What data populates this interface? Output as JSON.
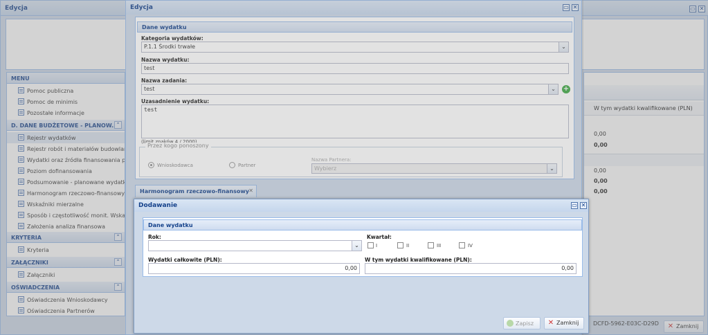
{
  "bg_window": {
    "title": "Edycja",
    "record_id": "DCFD-5962-E03C-D29D",
    "close_label": "Zamknij",
    "table_header": "W tym wydatki kwalifikowane (PLN)",
    "values": [
      "0,00",
      "0,00",
      "0,00",
      "0,00",
      "0,00"
    ]
  },
  "menu": {
    "header": "MENU",
    "top_items": [
      "Pomoc publiczna",
      "Pomoc de minimis",
      "Pozostałe informacje"
    ],
    "section_d": {
      "header": "D. DANE BUDŻETOWE - PLANOW...",
      "items": [
        "Rejestr wydatków",
        "Rejestr robót i materiałów budowlanych",
        "Wydatki oraz źródła finansowania projektu",
        "Poziom dofinansowania",
        "Podsumowanie - planowane wydatki w",
        "Harmonogram rzeczowo-finansowy",
        "Wskaźniki mierzalne",
        "Sposób i częstotliwość monit. Wskaźni",
        "Założenia analiza finansowa"
      ]
    },
    "kryteria": {
      "header": "KRYTERIA",
      "items": [
        "Kryteria"
      ]
    },
    "zalaczniki": {
      "header": "ZAŁĄCZNIKI",
      "items": [
        "Załączniki"
      ]
    },
    "oswiadczenia": {
      "header": "OŚWIADCZENIA",
      "items": [
        "Oświadczenia Wnioskodawcy",
        "Oświadczenia Partnerów"
      ]
    }
  },
  "edycja": {
    "title": "Edycja",
    "section_title": "Dane wydatku",
    "category_label": "Kategoria wydatków:",
    "category_value": "P.1.1 Środki trwałe",
    "name_label": "Nazwa wydatku:",
    "name_value": "test",
    "task_label": "Nazwa zadania:",
    "task_value": "test",
    "justification_label": "Uzasadnienie wydatku:",
    "justification_value": "test",
    "char_limit": "(limit znaków 4 / 2000)",
    "borne_by_legend": "Przez kogo ponoszony",
    "radio_applicant": "Wnioskodawca",
    "radio_partner": "Partner",
    "partner_name_label": "Nazwa Partnera:",
    "partner_name_placeholder": "Wybierz",
    "tab_label": "Harmonogram rzeczowo-finansowy"
  },
  "dodawanie": {
    "title": "Dodawanie",
    "section_title": "Dane wydatku",
    "year_label": "Rok:",
    "year_value": "",
    "quarter_label": "Kwartał:",
    "quarters": [
      "I",
      "II",
      "III",
      "IV"
    ],
    "total_label": "Wydatki całkowite (PLN):",
    "total_value": "0,00",
    "eligible_label": "W tym wydatki kwalifikowane (PLN):",
    "eligible_value": "0,00",
    "save_label": "Zapisz",
    "close_label": "Zamknij"
  }
}
